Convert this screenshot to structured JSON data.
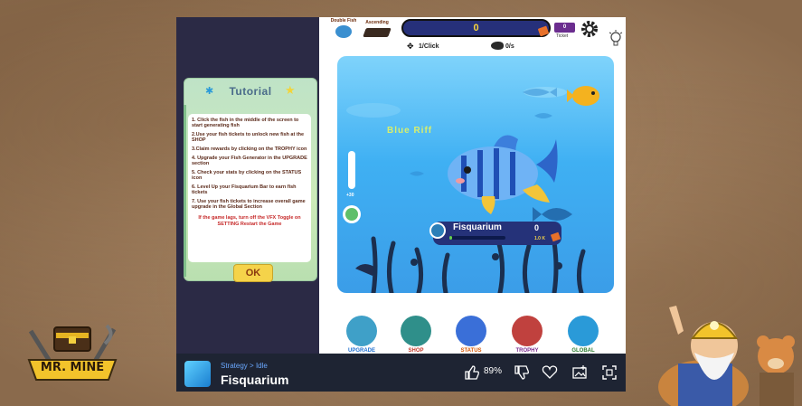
{
  "page": {
    "mrmine_logo_text": "MR. MINE"
  },
  "game": {
    "top_bar": {
      "double_fish_label": "Double Fish",
      "ascending_label": "Ascending",
      "counter_value": "0",
      "ticket_value": "0",
      "ticket_label": "Ticket",
      "per_click": "1/Click",
      "per_second": "0/s"
    },
    "tutorial": {
      "title": "Tutorial",
      "steps": [
        "1. Click the fish in the middle of the screen to start generating fish",
        "2.Use your fish tickets to unlock new fish at the SHOP",
        "3.Claim rewards by clicking on the TROPHY icon",
        "4. Upgrade your Fish Generator in the UPGRADE section",
        "5. Check your stats by clicking on the STATUS icon",
        "6. Level Up your Fisquarium Bar to earn fish tickets",
        "7. Use your fish tickets to increase overall game upgrade in the Global Section"
      ],
      "vfx_note": "If the game lags, turn off the VFX Toggle on SETTING Restart the Game",
      "ok_label": "OK"
    },
    "tank": {
      "fish_name": "Blue Riff",
      "side_badge": "+30",
      "info_title": "Fisquarium",
      "info_count": "0",
      "info_cost": "1.0 K",
      "level_progress": 0.05
    },
    "nav": [
      {
        "label": "UPGRADE",
        "color": "#1f6fd0",
        "icon_bg": "#3fa0c8"
      },
      {
        "label": "SHOP",
        "color": "#c0392b",
        "icon_bg": "#2f8f8a"
      },
      {
        "label": "STATUS",
        "color": "#d35400",
        "icon_bg": "#3a6fd8"
      },
      {
        "label": "TROPHY",
        "color": "#7b2d8f",
        "icon_bg": "#c0413e"
      },
      {
        "label": "GLOBAL",
        "color": "#2e7d32",
        "icon_bg": "#2a9ad8"
      }
    ]
  },
  "bottom_bar": {
    "category": "Strategy",
    "separator": ">",
    "subcategory": "Idle",
    "title": "Fisquarium",
    "rating": "89%"
  },
  "colors": {
    "left_panel": "#2b2a45",
    "counter_bar": "#26307a",
    "bottom_bar": "#1e2433",
    "accent_yellow": "#f7d53c"
  }
}
